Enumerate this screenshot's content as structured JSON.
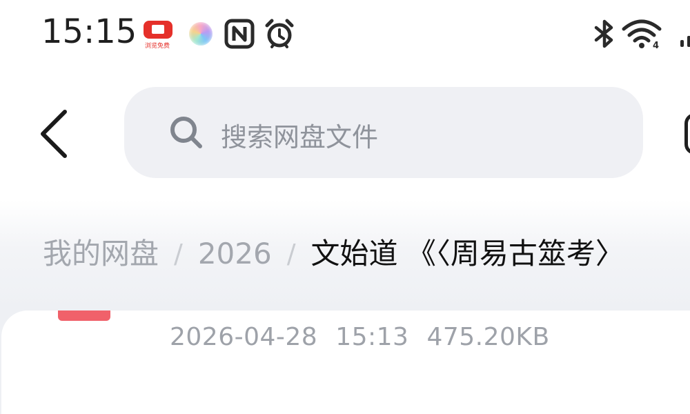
{
  "status_bar": {
    "time": "15:15",
    "news_app_caption": "浏览免费",
    "icons": [
      "news-app-icon",
      "assistant-app-icon",
      "nfc-icon",
      "alarm-icon",
      "bluetooth-icon",
      "wifi-icon",
      "signal-icon"
    ],
    "wifi_badge": "4"
  },
  "header": {
    "back_icon": "chevron-left-icon",
    "search": {
      "icon": "search-icon",
      "placeholder": "搜索网盘文件"
    }
  },
  "breadcrumb": {
    "items": [
      "我的网盘",
      "2026",
      "文始道 《〈周易古筮考〉"
    ],
    "separator": "/"
  },
  "file": {
    "date": "2026-04-28",
    "time": "15:13",
    "size": "475.20KB"
  },
  "colors": {
    "accent_red": "#e5302a",
    "file_icon": "#f0616a",
    "search_bg": "#eff0f4",
    "muted_text": "#a3a7ae"
  }
}
